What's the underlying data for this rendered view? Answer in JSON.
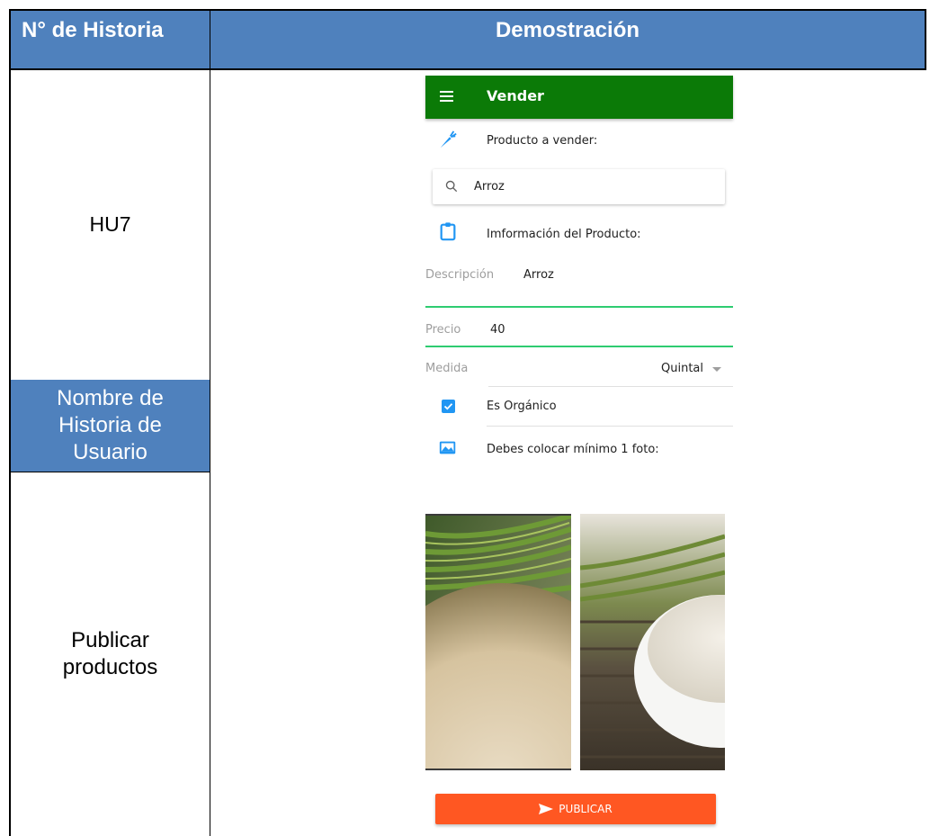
{
  "table": {
    "header_story_number": "N° de Historia",
    "header_demo": "Demostración",
    "story_id": "HU7",
    "story_name_label_lines": [
      "Nombre de",
      "Historia de",
      "Usuario"
    ],
    "story_name_lines": [
      "Publicar",
      "productos"
    ]
  },
  "app": {
    "title": "Vender",
    "product_section_label": "Producto a vender:",
    "search_value": "Arroz",
    "info_section_label": "Imformación del Producto:",
    "description": {
      "label": "Descripción",
      "value": "Arroz"
    },
    "price": {
      "label": "Precio",
      "value": "40"
    },
    "measure": {
      "label": "Medida",
      "selected": "Quintal"
    },
    "organic_checkbox": {
      "label": "Es Orgánico",
      "checked": true
    },
    "photos_section_label": "Debes colocar mínimo 1 foto:",
    "publish_button": "PUBLICAR",
    "colors": {
      "appbar": "#0b7a07",
      "accent_blue": "#2196f3",
      "field_underline": "#2ecc71",
      "publish": "#ff5722",
      "table_header": "#4f81bd"
    },
    "icons": [
      "menu-icon",
      "carrot-icon",
      "search-icon",
      "clipboard-icon",
      "checkbox-checked-icon",
      "image-icon",
      "send-icon",
      "dropdown-arrow-icon"
    ]
  }
}
